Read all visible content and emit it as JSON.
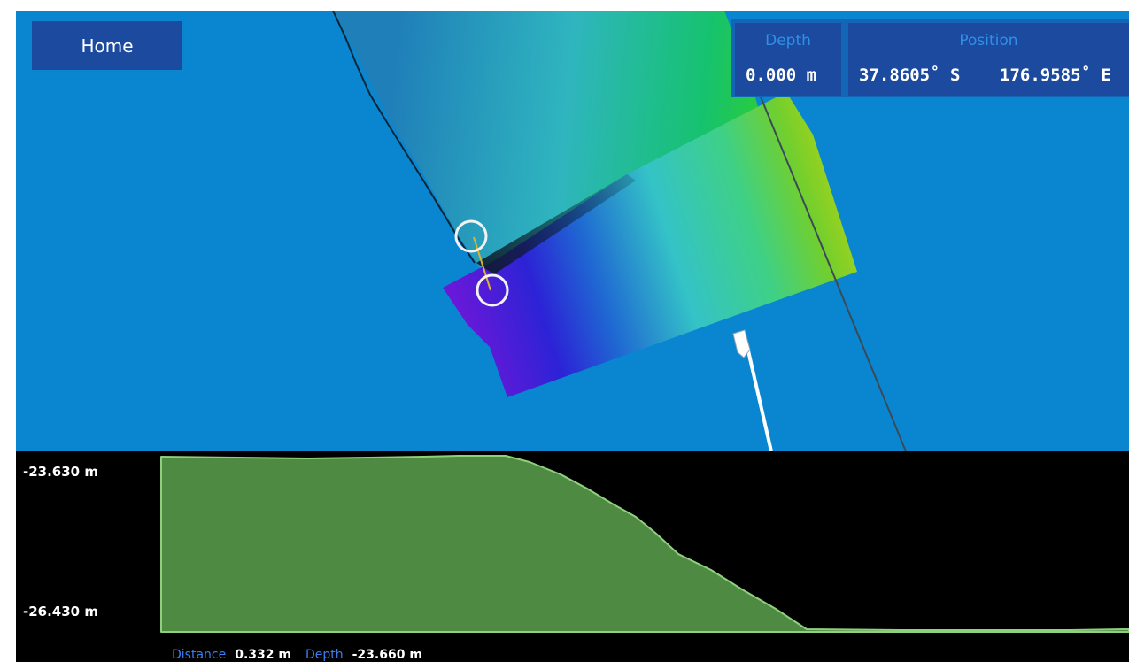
{
  "toolbar": {
    "home_label": "Home"
  },
  "info": {
    "depth": {
      "label": "Depth",
      "value": "0.000 m"
    },
    "position": {
      "label": "Position",
      "latitude": "37.8605˚ S",
      "longitude": "176.9585˚ E"
    }
  },
  "colors": {
    "water": "#0a86d1",
    "panel": "#1b4a9e",
    "panel_label": "#2f8fe9",
    "profile_fill": "#4f8a42",
    "profile_stroke": "#8fd07e",
    "readout_label": "#3a7ff0"
  },
  "profile": {
    "axis_top": "-23.630 m",
    "axis_bottom": "-26.430 m",
    "readout": {
      "distance_label": "Distance",
      "distance_value": "0.332 m",
      "depth_label": "Depth",
      "depth_value": "-23.660 m"
    }
  }
}
